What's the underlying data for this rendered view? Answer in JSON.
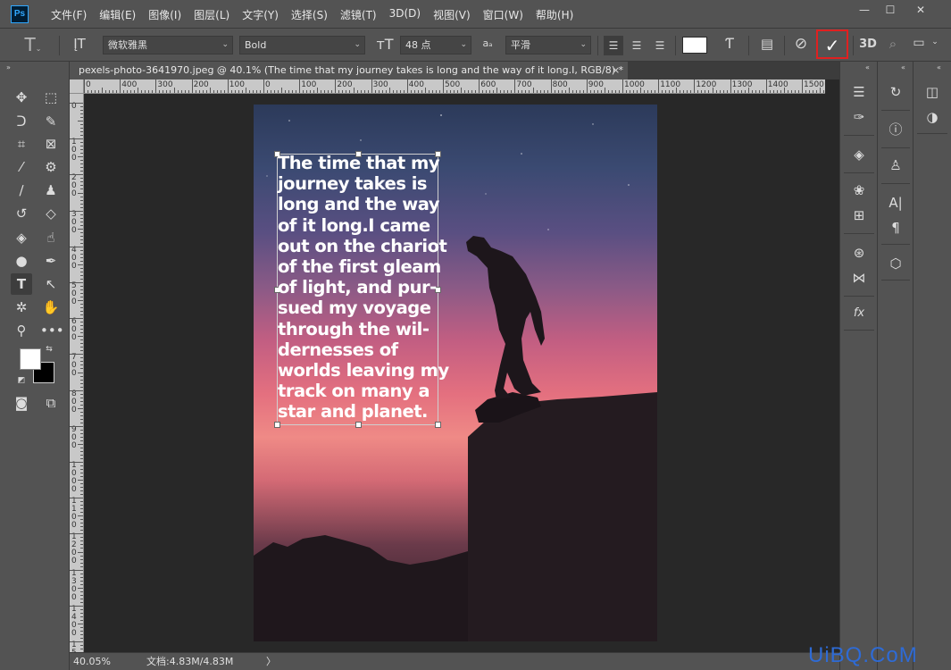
{
  "app": {
    "logo": "Ps"
  },
  "menu": [
    "文件(F)",
    "编辑(E)",
    "图像(I)",
    "图层(L)",
    "文字(Y)",
    "选择(S)",
    "滤镜(T)",
    "3D(D)",
    "视图(V)",
    "窗口(W)",
    "帮助(H)"
  ],
  "window_controls": {
    "minimize": "—",
    "restore": "☐",
    "close": "✕"
  },
  "options": {
    "font_family": "微软雅黑",
    "font_style": "Bold",
    "font_size": "48 点",
    "antialias_label": "a",
    "antialias": "平滑",
    "color_swatch": "#ffffff",
    "threed_label": "3D"
  },
  "document": {
    "tab_title": "pexels-photo-3641970.jpeg @ 40.1% (The time that my journey takes is long and the way of it long.I, RGB/8) *",
    "close": "×",
    "text_lines": [
      "The time that my",
      "journey takes is",
      "long and the way",
      "of it long.I came",
      "out on the chariot",
      "of the first gleam",
      "of light, and pur-",
      "sued my voyage",
      "through the wil-",
      "dernesses of",
      "worlds leaving my",
      "track on many a",
      "star and planet."
    ]
  },
  "ruler": {
    "top_labels": [
      "0",
      "400",
      "300",
      "200",
      "100",
      "0",
      "100",
      "200",
      "300",
      "400",
      "500",
      "600",
      "700",
      "800",
      "900",
      "1000",
      "1100",
      "1200",
      "1300",
      "1400",
      "1500"
    ],
    "left_labels": [
      "0",
      "1\n0\n0",
      "2\n0\n0",
      "3\n0\n0",
      "4\n0\n0",
      "5\n0\n0",
      "6\n0\n0",
      "7\n0\n0",
      "8\n0\n0",
      "9\n0\n0",
      "1\n0\n0\n0",
      "1\n1\n0\n0",
      "1\n2\n0\n0",
      "1\n3\n0\n0",
      "1\n4\n0\n0",
      "1\n5\n0\n0"
    ]
  },
  "status": {
    "zoom": "40.05%",
    "doc_size": "文档:4.83M/4.83M",
    "arrow": "〉"
  },
  "watermark": "UiBQ.CoM",
  "colors": {
    "accent_highlight": "#e02020",
    "foreground": "#ffffff",
    "background": "#000000"
  }
}
